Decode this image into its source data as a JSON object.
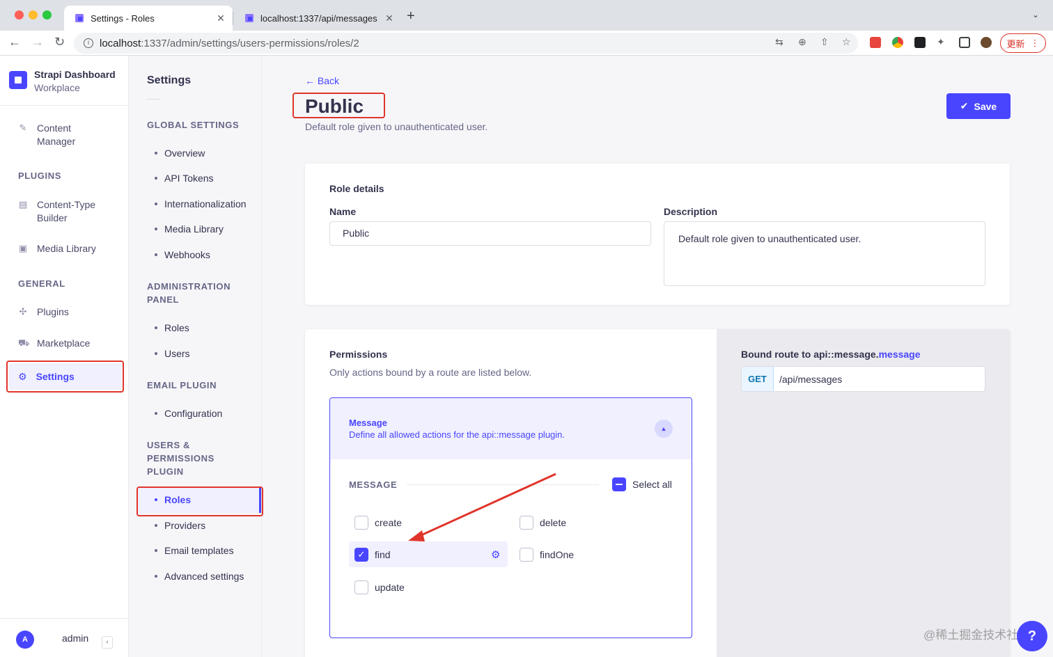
{
  "browser": {
    "tabs": [
      {
        "title": "Settings - Roles",
        "active": true
      },
      {
        "title": "localhost:1337/api/messages",
        "active": false
      }
    ],
    "url_host": "localhost",
    "url_rest": ":1337/admin/settings/users-permissions/roles/2",
    "update_label": "更新"
  },
  "mainnav": {
    "brand_name": "Strapi Dashboard",
    "workspace": "Workplace",
    "content_manager": "Content\nManager",
    "plugins_heading": "PLUGINS",
    "ctb": "Content-Type\nBuilder",
    "media_library": "Media Library",
    "general_heading": "GENERAL",
    "plugins": "Plugins",
    "marketplace": "Marketplace",
    "settings": "Settings",
    "user_initial": "A",
    "user_name": "admin"
  },
  "subnav": {
    "title": "Settings",
    "global_heading": "GLOBAL SETTINGS",
    "global_items": [
      "Overview",
      "API Tokens",
      "Internationalization",
      "Media Library",
      "Webhooks"
    ],
    "admin_heading": "ADMINISTRATION PANEL",
    "admin_items": [
      "Roles",
      "Users"
    ],
    "email_heading": "EMAIL PLUGIN",
    "email_items": [
      "Configuration"
    ],
    "up_heading": "USERS & PERMISSIONS PLUGIN",
    "up_items": [
      "Roles",
      "Providers",
      "Email templates",
      "Advanced settings"
    ]
  },
  "header": {
    "back": "Back",
    "title": "Public",
    "subtitle": "Default role given to unauthenticated user.",
    "save": "Save"
  },
  "role_details": {
    "heading": "Role details",
    "name_label": "Name",
    "name_value": "Public",
    "description_label": "Description",
    "description_value": "Default role given to unauthenticated user."
  },
  "permissions": {
    "heading": "Permissions",
    "subtitle": "Only actions bound by a route are listed below.",
    "accordion_title": "Message",
    "accordion_desc": "Define all allowed actions for the api::message plugin.",
    "section": "MESSAGE",
    "select_all": "Select all",
    "actions": {
      "create": "create",
      "delete": "delete",
      "find": "find",
      "findOne": "findOne",
      "update": "update"
    }
  },
  "bound_route": {
    "title_prefix": "Bound route to api::message.",
    "title_highlight": "message",
    "method": "GET",
    "path": "/api/messages"
  },
  "watermark": "@稀土掘金技术社区",
  "colors": {
    "primary": "#4945ff",
    "annotation_red": "#e0352b"
  }
}
